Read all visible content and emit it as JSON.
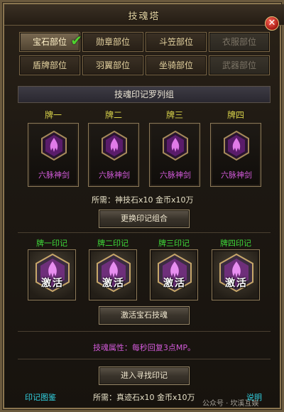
{
  "window": {
    "title": "技魂塔",
    "close_symbol": "✕"
  },
  "tabs": [
    {
      "label": "宝石部位",
      "state": "active"
    },
    {
      "label": "勋章部位",
      "state": "normal"
    },
    {
      "label": "斗笠部位",
      "state": "normal"
    },
    {
      "label": "衣服部位",
      "state": "disabled"
    },
    {
      "label": "盾牌部位",
      "state": "normal"
    },
    {
      "label": "羽翼部位",
      "state": "normal"
    },
    {
      "label": "坐骑部位",
      "state": "normal"
    },
    {
      "label": "武器部位",
      "state": "disabled"
    }
  ],
  "section_title": "技魂印记罗列组",
  "cards": [
    {
      "label": "牌一",
      "name": "六脉神剑"
    },
    {
      "label": "牌二",
      "name": "六脉神剑"
    },
    {
      "label": "牌三",
      "name": "六脉神剑"
    },
    {
      "label": "牌四",
      "name": "六脉神剑"
    }
  ],
  "requirement_1": "所需：神技石x10 金币x10万",
  "change_button": "更换印记组合",
  "seals": [
    {
      "label": "牌一印记",
      "text": "激活"
    },
    {
      "label": "牌二印记",
      "text": "激活"
    },
    {
      "label": "牌三印记",
      "text": "激活"
    },
    {
      "label": "牌四印记",
      "text": "激活"
    }
  ],
  "activate_button": "激活宝石技魂",
  "attribute_text": "技魂属性：每秒回复3点MP。",
  "enter_button": "进入寻找印记",
  "bottom": {
    "left_link": "印记图鉴",
    "requirement_2": "所需：真迹石x10 金币x10万",
    "right_link": "说明",
    "watermark": "公众号 · 坎溪互娱"
  },
  "colors": {
    "frame_gold": "#8a7550",
    "card_name_purple": "#d25ad9",
    "seal_label_green": "#3fdc3a",
    "card_label_yellow": "#d8d24a",
    "link_cyan": "#31d0e0"
  },
  "icons": {
    "close": "close-icon",
    "check": "checkmark-icon",
    "card": "flame-emblem-icon",
    "seal": "hexagon-seal-icon"
  }
}
